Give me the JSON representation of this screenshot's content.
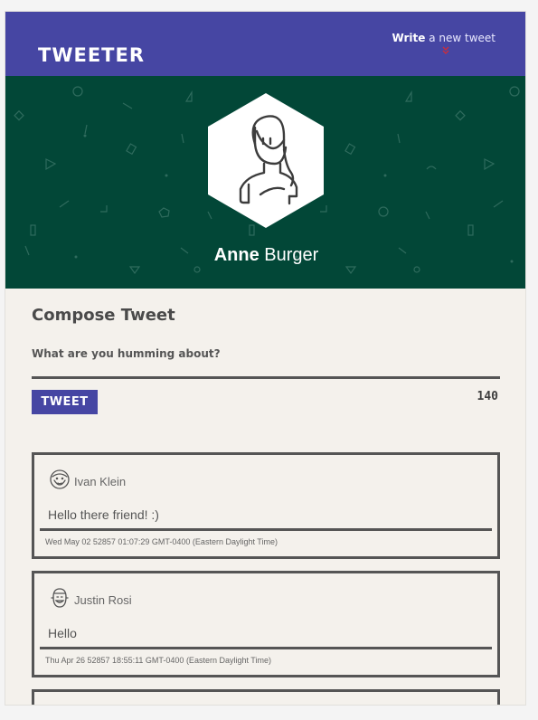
{
  "header": {
    "brand": "TWEETER",
    "write_bold": "Write",
    "write_rest": " a new tweet",
    "accent_color": "#4646a3",
    "chevron_icon": "double-chevron-down-icon",
    "chevron_color": "#cc2d3b"
  },
  "profile": {
    "first_name": "Anne",
    "last_name": " Burger",
    "banner_color": "#024737",
    "avatar_icon": "woman-avatar-icon"
  },
  "compose": {
    "title": "Compose Tweet",
    "prompt": "What are you humming about?",
    "button_label": "TWEET",
    "counter": "140"
  },
  "tweets": [
    {
      "author": "Ivan Klein",
      "avatar_icon": "bearded-man-avatar-icon",
      "text": "Hello there friend! :)",
      "timestamp": "Wed May 02 52857 01:07:29 GMT-0400 (Eastern Daylight Time)"
    },
    {
      "author": "Justin Rosi",
      "avatar_icon": "smiling-man-avatar-icon",
      "text": "Hello",
      "timestamp": "Thu Apr 26 52857 18:55:11 GMT-0400 (Eastern Daylight Time)"
    }
  ]
}
